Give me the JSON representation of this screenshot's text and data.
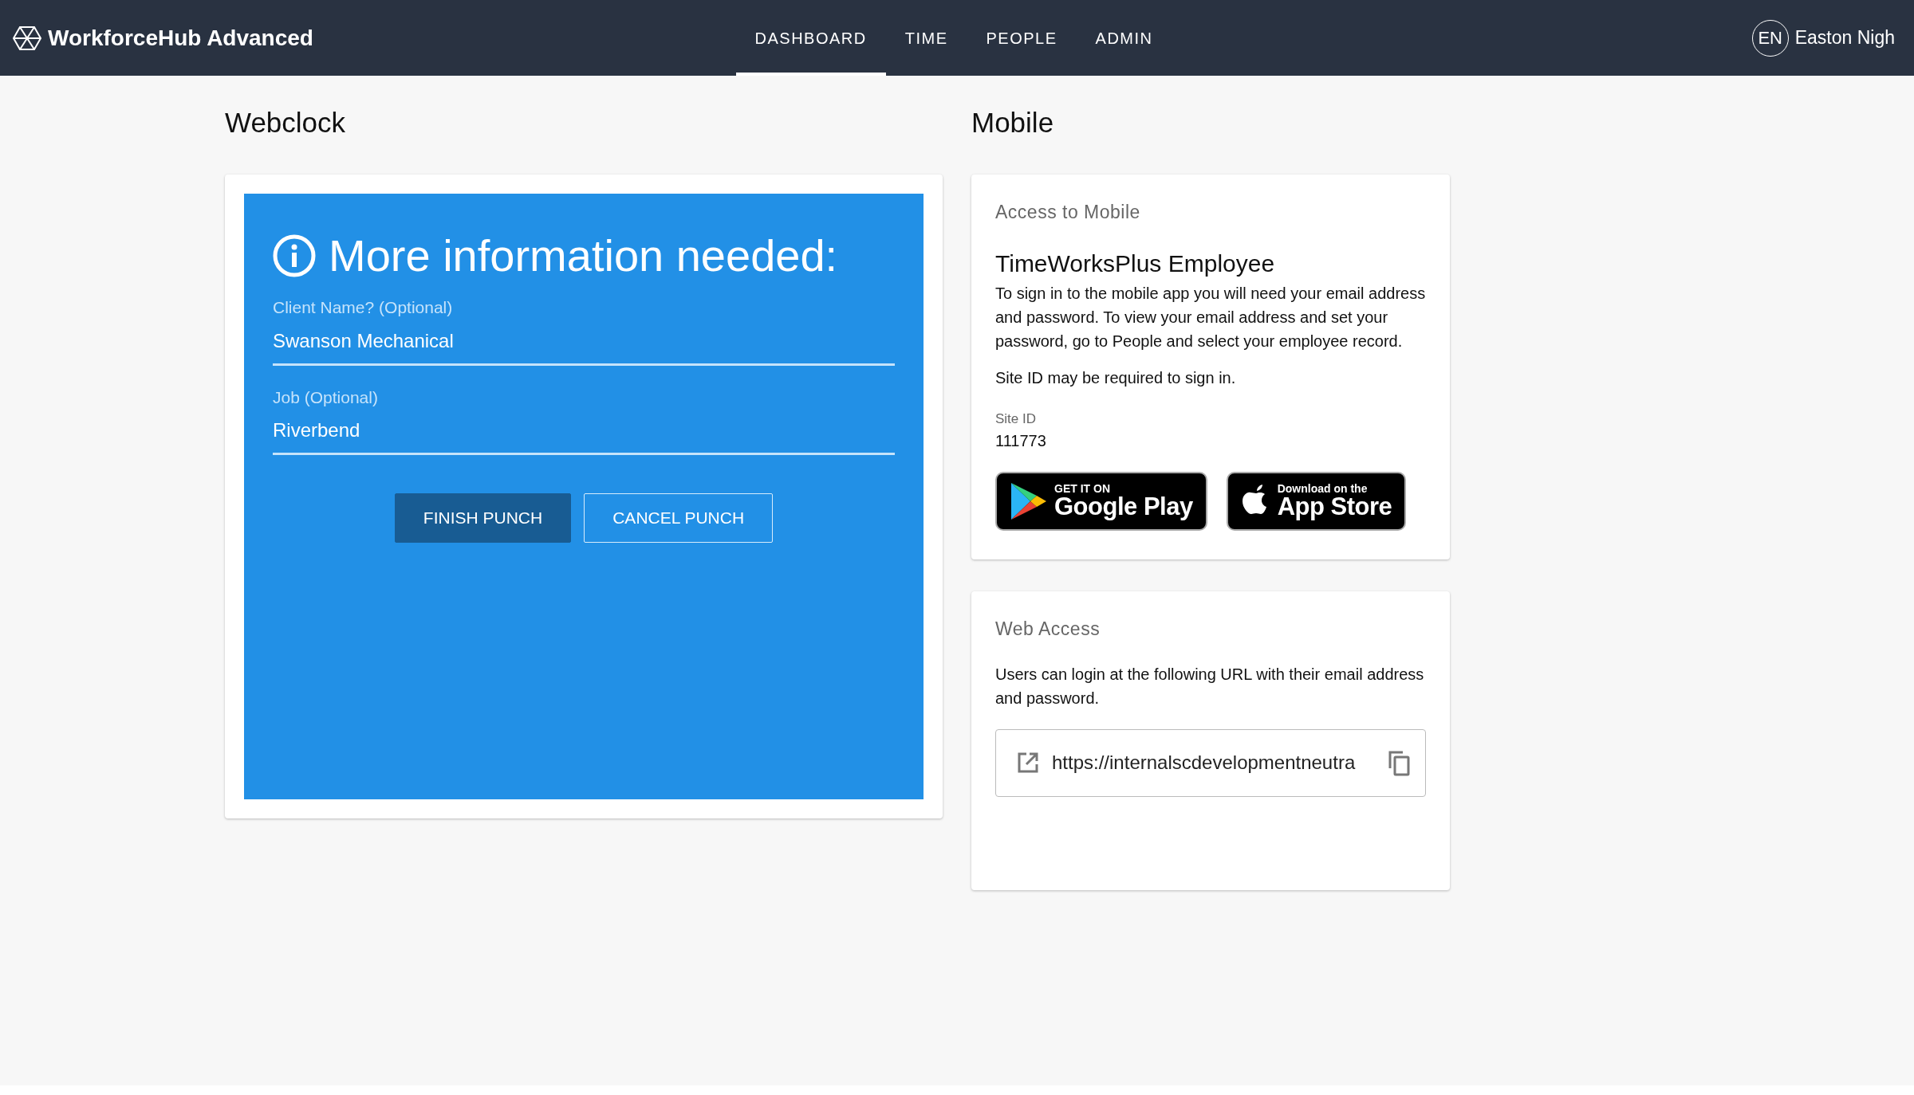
{
  "app": {
    "title": "WorkforceHub Advanced"
  },
  "nav": [
    {
      "label": "DASHBOARD",
      "selected": true
    },
    {
      "label": "TIME",
      "selected": false
    },
    {
      "label": "PEOPLE",
      "selected": false
    },
    {
      "label": "ADMIN",
      "selected": false
    }
  ],
  "user": {
    "initials": "EN",
    "name": "Easton Nigh"
  },
  "webclock": {
    "title": "Webclock",
    "prompt": {
      "heading": "More information needed:",
      "fields": [
        {
          "label": "Client Name? (Optional)",
          "value": "Swanson Mechanical"
        },
        {
          "label": "Job (Optional)",
          "value": "Riverbend"
        }
      ],
      "buttons": [
        {
          "label": "FINISH PUNCH",
          "kind": "primary"
        },
        {
          "label": "CANCEL PUNCH",
          "kind": "outline"
        }
      ]
    }
  },
  "mobile": {
    "title": "Mobile",
    "access_card": {
      "title": "Access to Mobile",
      "app_name": "TimeWorksPlus Employee",
      "paragraphs": [
        "To sign in to the mobile app you will need your email address and password. To view your email address and set your password, go to People and select your employee record.",
        "Site ID may be required to sign in."
      ],
      "site_id_label": "Site ID",
      "site_id": "111773",
      "store_badges": [
        {
          "kind": "google",
          "small": "GET IT ON",
          "large": "Google Play"
        },
        {
          "kind": "apple",
          "small": "Download on the",
          "large": "App Store"
        }
      ]
    },
    "web_card": {
      "title": "Web Access",
      "text": "Users can login at the following URL with their email address and password.",
      "url": "https://internalscdevelopmentneutra"
    }
  }
}
